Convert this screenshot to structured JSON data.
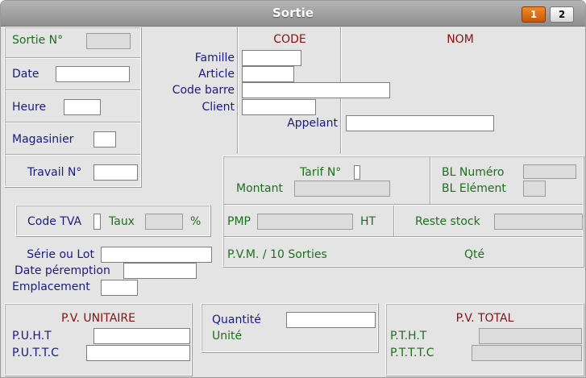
{
  "window": {
    "title": "Sortie"
  },
  "pages": [
    {
      "label": "1"
    },
    {
      "label": "2"
    }
  ],
  "colors": {
    "page_active": "#e06c12",
    "label_blue": "#1a1a80",
    "label_green": "#1f6e1f",
    "label_red": "#8a1010"
  },
  "left": {
    "sortie_no": {
      "label": "Sortie N°",
      "value": ""
    },
    "date": {
      "label": "Date",
      "value": ""
    },
    "heure": {
      "label": "Heure",
      "value": ""
    },
    "magasinier": {
      "label": "Magasinier",
      "value": ""
    },
    "travail_no": {
      "label": "Travail N°",
      "value": ""
    }
  },
  "code_col": {
    "header": "CODE"
  },
  "nom_col": {
    "header": "NOM"
  },
  "codes": {
    "famille": {
      "label": "Famille",
      "value": ""
    },
    "article": {
      "label": "Article",
      "value": ""
    },
    "code_barre": {
      "label": "Code barre",
      "value": ""
    },
    "client": {
      "label": "Client",
      "value": ""
    },
    "appelant": {
      "label": "Appelant",
      "value": ""
    }
  },
  "tarif": {
    "tarif_no": {
      "label": "Tarif N°",
      "value": ""
    },
    "montant": {
      "label": "Montant",
      "value": ""
    }
  },
  "bl": {
    "numero": {
      "label": "BL Numéro",
      "value": ""
    },
    "element": {
      "label": "BL Elément",
      "value": ""
    }
  },
  "tva": {
    "code": {
      "label": "Code TVA",
      "value": ""
    },
    "taux": {
      "label": "Taux",
      "value": ""
    },
    "percent": "%"
  },
  "pmp": {
    "label": "PMP",
    "value": "",
    "ht": "HT"
  },
  "reste_stock": {
    "label": "Reste stock",
    "value": ""
  },
  "pvm": {
    "label": "P.V.M. / 10 Sorties",
    "qte": "Qté"
  },
  "lot": {
    "serie": {
      "label": "Série ou Lot",
      "value": ""
    },
    "peremption": {
      "label": "Date péremption",
      "value": ""
    },
    "emplacement": {
      "label": "Emplacement",
      "value": ""
    }
  },
  "pv_unitaire": {
    "header": "P.V. UNITAIRE",
    "puht": {
      "label": "P.U.H.T",
      "value": ""
    },
    "puttc": {
      "label": "P.U.T.T.C",
      "value": ""
    }
  },
  "quantite": {
    "label": "Quantité",
    "value": "",
    "unite": "Unité"
  },
  "pv_total": {
    "header": "P.V. TOTAL",
    "ptht": {
      "label": "P.T.H.T",
      "value": ""
    },
    "ptttc": {
      "label": "P.T.T.T.C",
      "value": ""
    }
  }
}
